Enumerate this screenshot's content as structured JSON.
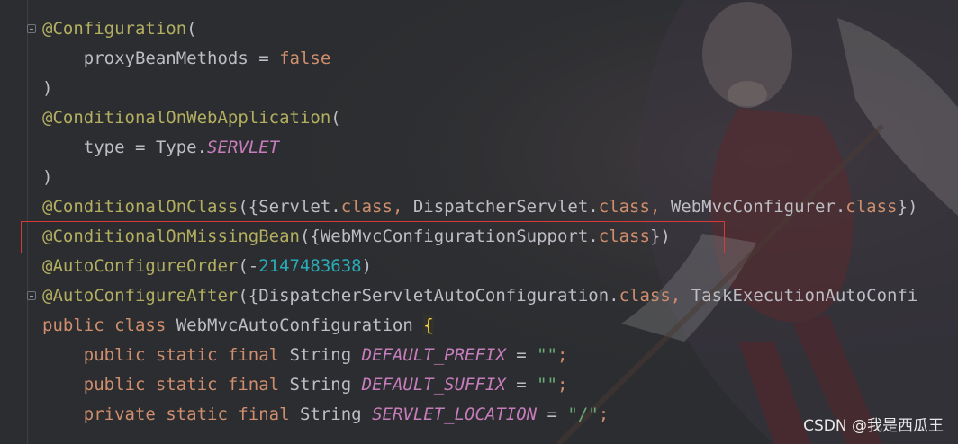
{
  "editor": {
    "lines": [
      [
        {
          "t": "@Configuration",
          "c": "ann"
        },
        {
          "t": "(",
          "c": "plain"
        }
      ],
      [
        {
          "t": "    proxyBeanMethods = ",
          "c": "plain"
        },
        {
          "t": "false",
          "c": "kw"
        }
      ],
      [
        {
          "t": ")",
          "c": "plain"
        }
      ],
      [
        {
          "t": "@ConditionalOnWebApplication",
          "c": "ann"
        },
        {
          "t": "(",
          "c": "plain"
        }
      ],
      [
        {
          "t": "    type = Type.",
          "c": "plain"
        },
        {
          "t": "SERVLET",
          "c": "const"
        }
      ],
      [
        {
          "t": ")",
          "c": "plain"
        }
      ],
      [
        {
          "t": "@ConditionalOnClass",
          "c": "ann"
        },
        {
          "t": "({Servlet.",
          "c": "plain"
        },
        {
          "t": "class",
          "c": "kw"
        },
        {
          "t": ", ",
          "c": "kw"
        },
        {
          "t": "DispatcherServlet.",
          "c": "plain"
        },
        {
          "t": "class",
          "c": "kw"
        },
        {
          "t": ", ",
          "c": "kw"
        },
        {
          "t": "WebMvcConfigurer.",
          "c": "plain"
        },
        {
          "t": "class",
          "c": "kw"
        },
        {
          "t": "})",
          "c": "plain"
        }
      ],
      [
        {
          "t": "@ConditionalOnMissingBean",
          "c": "ann"
        },
        {
          "t": "({WebMvcConfigurationSupport.",
          "c": "plain"
        },
        {
          "t": "class",
          "c": "kw"
        },
        {
          "t": "})",
          "c": "plain"
        }
      ],
      [
        {
          "t": "@AutoConfigureOrder",
          "c": "ann"
        },
        {
          "t": "(-",
          "c": "plain"
        },
        {
          "t": "2147483638",
          "c": "num"
        },
        {
          "t": ")",
          "c": "plain"
        }
      ],
      [
        {
          "t": "@AutoConfigureAfter",
          "c": "ann"
        },
        {
          "t": "({DispatcherServletAutoConfiguration.",
          "c": "plain"
        },
        {
          "t": "class",
          "c": "kw"
        },
        {
          "t": ", ",
          "c": "kw"
        },
        {
          "t": "TaskExecutionAutoConfi",
          "c": "plain"
        }
      ],
      [
        {
          "t": "public class ",
          "c": "kw"
        },
        {
          "t": "WebMvcAutoConfiguration ",
          "c": "plain"
        },
        {
          "t": "{",
          "c": "brace-hl"
        }
      ],
      [
        {
          "t": "    public static final ",
          "c": "kw"
        },
        {
          "t": "String ",
          "c": "plain"
        },
        {
          "t": "DEFAULT_PREFIX",
          "c": "const"
        },
        {
          "t": " = ",
          "c": "plain"
        },
        {
          "t": "\"\"",
          "c": "str"
        },
        {
          "t": ";",
          "c": "kw"
        }
      ],
      [
        {
          "t": "    public static final ",
          "c": "kw"
        },
        {
          "t": "String ",
          "c": "plain"
        },
        {
          "t": "DEFAULT_SUFFIX",
          "c": "const"
        },
        {
          "t": " = ",
          "c": "plain"
        },
        {
          "t": "\"\"",
          "c": "str"
        },
        {
          "t": ";",
          "c": "kw"
        }
      ],
      [
        {
          "t": "    private static final ",
          "c": "kw"
        },
        {
          "t": "String ",
          "c": "plain"
        },
        {
          "t": "SERVLET_LOCATION",
          "c": "const"
        },
        {
          "t": " = ",
          "c": "plain"
        },
        {
          "t": "\"/\"",
          "c": "str"
        },
        {
          "t": ";",
          "c": "kw"
        }
      ]
    ],
    "highlighted_line_index": 7,
    "highlight_color": "#d73a3a"
  },
  "watermark": {
    "text": "CSDN @我是西瓜王"
  },
  "icons": {
    "fold": "fold-marker-icon"
  }
}
